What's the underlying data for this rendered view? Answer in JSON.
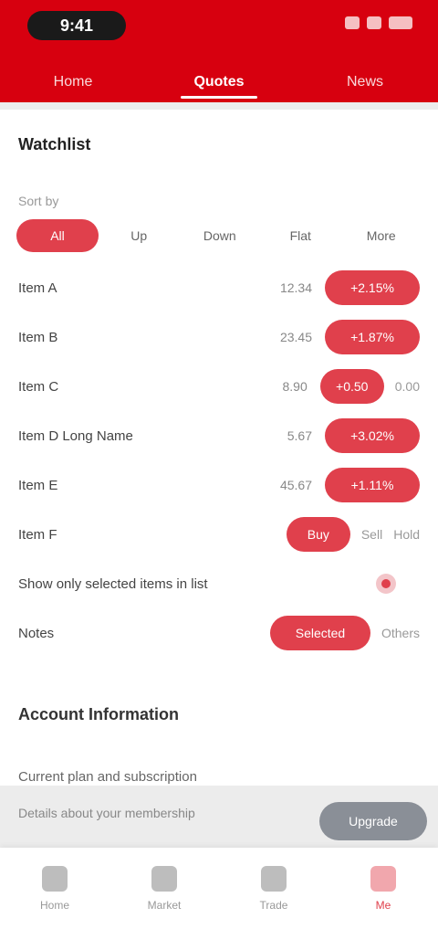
{
  "status": {
    "time": "9:41"
  },
  "tabs": [
    {
      "label": "Home"
    },
    {
      "label": "Quotes"
    },
    {
      "label": "News"
    }
  ],
  "card": {
    "title": "Watchlist",
    "subtitle": "Sort by",
    "filters": [
      {
        "label": "All"
      },
      {
        "label": "Up"
      },
      {
        "label": "Down"
      },
      {
        "label": "Flat"
      },
      {
        "label": "More"
      }
    ],
    "rows": [
      {
        "label": "Item A",
        "value": "12.34",
        "pill": "+2.15%"
      },
      {
        "label": "Item B",
        "value": "23.45",
        "pill": "+1.87%"
      },
      {
        "label": "Item C",
        "value": "8.90",
        "pill": "+0.50",
        "opt": "0.00"
      },
      {
        "label": "Item D Long Name",
        "value": "5.67",
        "pill": "+3.02%"
      },
      {
        "label": "Item E",
        "value": "45.67",
        "pill": "+1.11%"
      },
      {
        "label": "Item F",
        "pill": "Buy",
        "opt1": "Sell",
        "opt2": "Hold"
      },
      {
        "label": "Show only selected items in list"
      },
      {
        "label": "Notes",
        "pill": "Selected",
        "opt": "Others"
      }
    ]
  },
  "section": {
    "title": "Account Information",
    "line": "Current plan and subscription",
    "line2": "Details about your membership",
    "button": "Upgrade"
  },
  "nav": [
    {
      "label": "Home"
    },
    {
      "label": "Market"
    },
    {
      "label": "Trade"
    },
    {
      "label": "Me"
    }
  ]
}
